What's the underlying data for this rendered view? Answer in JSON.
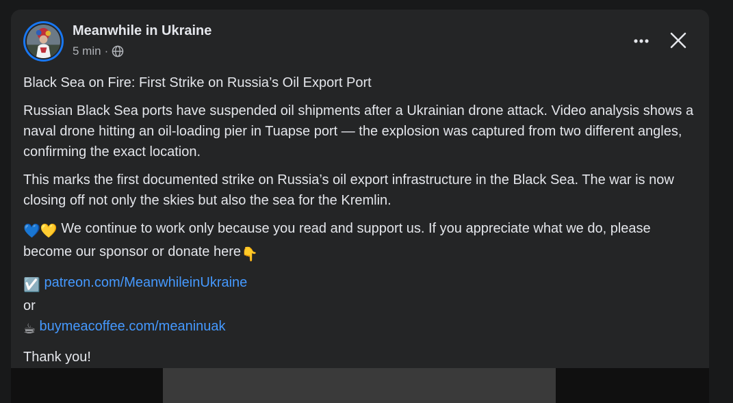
{
  "post": {
    "author": "Meanwhile in Ukraine",
    "time": "5 min",
    "separator": "·",
    "visibility_icon": "globe-icon",
    "more_icon": "more-horizontal-icon",
    "close_icon": "close-icon",
    "title": "Black Sea on Fire: First Strike on Russia’s Oil Export Port",
    "paragraph1": "Russian Black Sea ports have suspended oil shipments after a Ukrainian drone attack. Video analysis shows a naval drone hitting an oil-loading pier in Tuapse port — the explosion was captured from two different angles, confirming the exact location.",
    "paragraph2": "This marks the first documented strike on Russia’s oil export infrastructure in the Black Sea. The war is now closing off not only the skies but also the sea for the Kremlin.",
    "support_emoji": "💙💛",
    "support_text": " We continue to work only because you read and support us. If you appreciate what we do, please become our sponsor or donate here",
    "point_emoji": "👇",
    "check_emoji": "☑️",
    "patreon_link": "patreon.com/MeanwhileinUkraine",
    "or_text": "or",
    "coffee_emoji": "☕",
    "coffee_link": "buymeacoffee.com/meaninuak",
    "thanks": "Thank you!"
  },
  "colors": {
    "background": "#18191a",
    "card": "#242526",
    "text": "#e4e6eb",
    "secondary_text": "#b0b3b8",
    "link": "#4599ff",
    "avatar_ring": "#1877f2"
  }
}
